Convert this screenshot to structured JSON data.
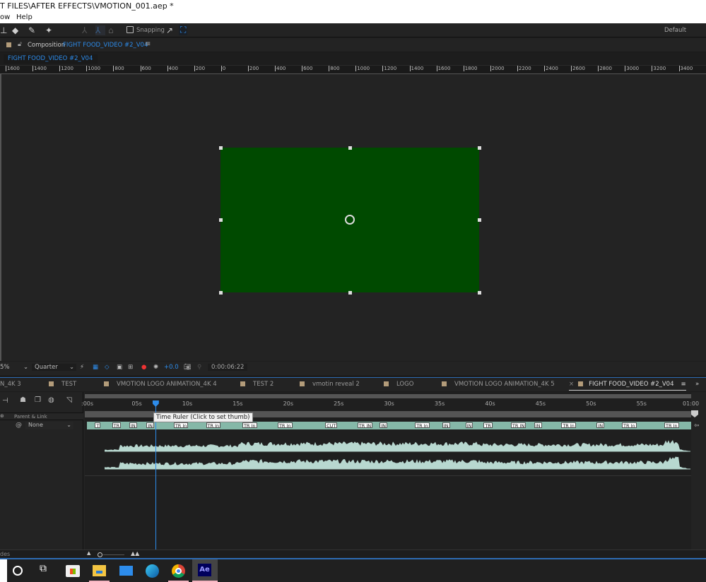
{
  "title": "T FILES\\AFTER EFFECTS\\VMOTION_001.aep *",
  "menu": [
    "ow",
    "Help"
  ],
  "toolbar": {
    "snapping": "Snapping",
    "workspace": "Default"
  },
  "composition": {
    "label": "Composition",
    "name": "FIGHT FOOD_VIDEO #2_V04",
    "breadcrumb": "FIGHT FOOD_VIDEO #2_V04",
    "bg_color": "#004a00"
  },
  "ruler": [
    "1600",
    "1400",
    "1200",
    "1000",
    "800",
    "600",
    "400",
    "200",
    "0",
    "200",
    "400",
    "600",
    "800",
    "1000",
    "1200",
    "1400",
    "1600",
    "1800",
    "2000",
    "2200",
    "2400",
    "2600",
    "2800",
    "3000",
    "3200",
    "3400"
  ],
  "viewer_controls": {
    "zoom": "5%",
    "resolution": "Quarter",
    "exposure": "+0.0",
    "timecode": "0:00:06:22"
  },
  "timeline_tabs": [
    {
      "label": "N_4K 3"
    },
    {
      "label": "TEST"
    },
    {
      "label": "VMOTION LOGO ANIMATION_4K 4"
    },
    {
      "label": "TEST 2"
    },
    {
      "label": "vmotin reveal 2"
    },
    {
      "label": "LOGO"
    },
    {
      "label": "VMOTION LOGO ANIMATION_4K 5"
    },
    {
      "label": "FIGHT FOOD_VIDEO #2_V04",
      "active": true
    }
  ],
  "time_ticks": [
    ":00s",
    "05s",
    "10s",
    "15s",
    "20s",
    "25s",
    "30s",
    "35s",
    "40s",
    "45s",
    "50s",
    "55s",
    "01:00"
  ],
  "playhead_seconds": 6.92,
  "duration_seconds": 60,
  "tooltip": "Time Ruler (Click to set thumb)",
  "layer": {
    "parent_header": "Parent & Link",
    "parent_value": "None"
  },
  "markers": [
    {
      "t": 0.8,
      "l": "T"
    },
    {
      "t": 2.5,
      "l": "TR"
    },
    {
      "t": 4.2,
      "l": "IN"
    },
    {
      "t": 5.9,
      "l": "IN"
    },
    {
      "t": 8.6,
      "l": "TR In"
    },
    {
      "t": 11.8,
      "l": "TR In"
    },
    {
      "t": 15.4,
      "l": "TR In"
    },
    {
      "t": 18.9,
      "l": "TR In"
    },
    {
      "t": 23.6,
      "l": "CUT"
    },
    {
      "t": 26.8,
      "l": "TR IN"
    },
    {
      "t": 29.0,
      "l": "IN"
    },
    {
      "t": 32.5,
      "l": "TR In"
    },
    {
      "t": 35.2,
      "l": "IN"
    },
    {
      "t": 37.5,
      "l": "IN"
    },
    {
      "t": 39.3,
      "l": "TR"
    },
    {
      "t": 42.0,
      "l": "TR IN"
    },
    {
      "t": 44.3,
      "l": "IN"
    },
    {
      "t": 47.0,
      "l": "TR In"
    },
    {
      "t": 50.5,
      "l": "IN"
    },
    {
      "t": 53.0,
      "l": "TR In"
    },
    {
      "t": 57.2,
      "l": "TR In"
    }
  ],
  "bottom": {
    "left_text": "des"
  },
  "taskbar": [
    "search",
    "task-view",
    "store",
    "file-explorer",
    "mail",
    "edge",
    "chrome",
    "after-effects"
  ],
  "taskbar_ae": "Ae"
}
